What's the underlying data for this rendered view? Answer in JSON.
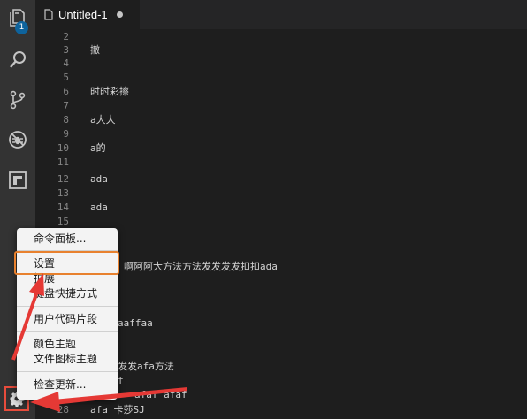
{
  "activity_bar": {
    "badge": "1"
  },
  "tab": {
    "title": "Untitled-1"
  },
  "editor_lines": [
    {
      "n": "2",
      "t": ""
    },
    {
      "n": "3",
      "t": "撤"
    },
    {
      "n": "4",
      "t": ""
    },
    {
      "n": "5",
      "t": ""
    },
    {
      "n": "6",
      "t": "时时彩擦"
    },
    {
      "n": "7",
      "t": ""
    },
    {
      "n": "8",
      "t": "a大大"
    },
    {
      "n": "9",
      "t": ""
    },
    {
      "n": "10",
      "t": "a的"
    },
    {
      "n": "11",
      "t": ""
    },
    {
      "n": "12",
      "t": "ada"
    },
    {
      "n": "13",
      "t": ""
    },
    {
      "n": "14",
      "t": "ada"
    },
    {
      "n": "15",
      "t": ""
    },
    {
      "n": "28",
      "t": "afa 卡莎SJ"
    }
  ],
  "partial_code": {
    "line_a": "啊阿阿大方法方法发发发发扣扣ada",
    "line_b": "aaffaa",
    "line_c": "发发afa方法",
    "line_d": "f",
    "line_e": "afaf afaf"
  },
  "context_menu": {
    "command_palette": "命令面板...",
    "settings": "设置",
    "extensions": "扩展",
    "keyboard_shortcuts": "键盘快捷方式",
    "user_snippets": "用户代码片段",
    "color_theme": "颜色主题",
    "file_icon_theme": "文件图标主题",
    "check_updates": "检查更新..."
  }
}
